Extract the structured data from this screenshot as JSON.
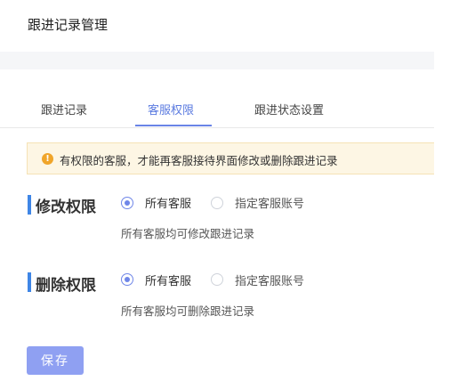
{
  "page": {
    "title": "跟进记录管理"
  },
  "tabs": [
    {
      "label": "跟进记录",
      "active": false
    },
    {
      "label": "客服权限",
      "active": true
    },
    {
      "label": "跟进状态设置",
      "active": false
    }
  ],
  "notice": {
    "icon": "warning-icon",
    "text": "有权限的客服，才能再客服接待界面修改或删除跟进记录"
  },
  "sections": [
    {
      "title": "修改权限",
      "options": [
        {
          "label": "所有客服",
          "checked": true
        },
        {
          "label": "指定客服账号",
          "checked": false
        }
      ],
      "hint": "所有客服均可修改跟进记录"
    },
    {
      "title": "删除权限",
      "options": [
        {
          "label": "所有客服",
          "checked": true
        },
        {
          "label": "指定客服账号",
          "checked": false
        }
      ],
      "hint": "所有客服均可删除跟进记录"
    }
  ],
  "actions": {
    "save_label": "保存"
  },
  "colors": {
    "accent": "#6f86e8",
    "section_bar": "#3f86e6",
    "notice_bg": "#fdf6e4",
    "warning": "#f0a52a",
    "save_button": "#8fa0f2"
  }
}
